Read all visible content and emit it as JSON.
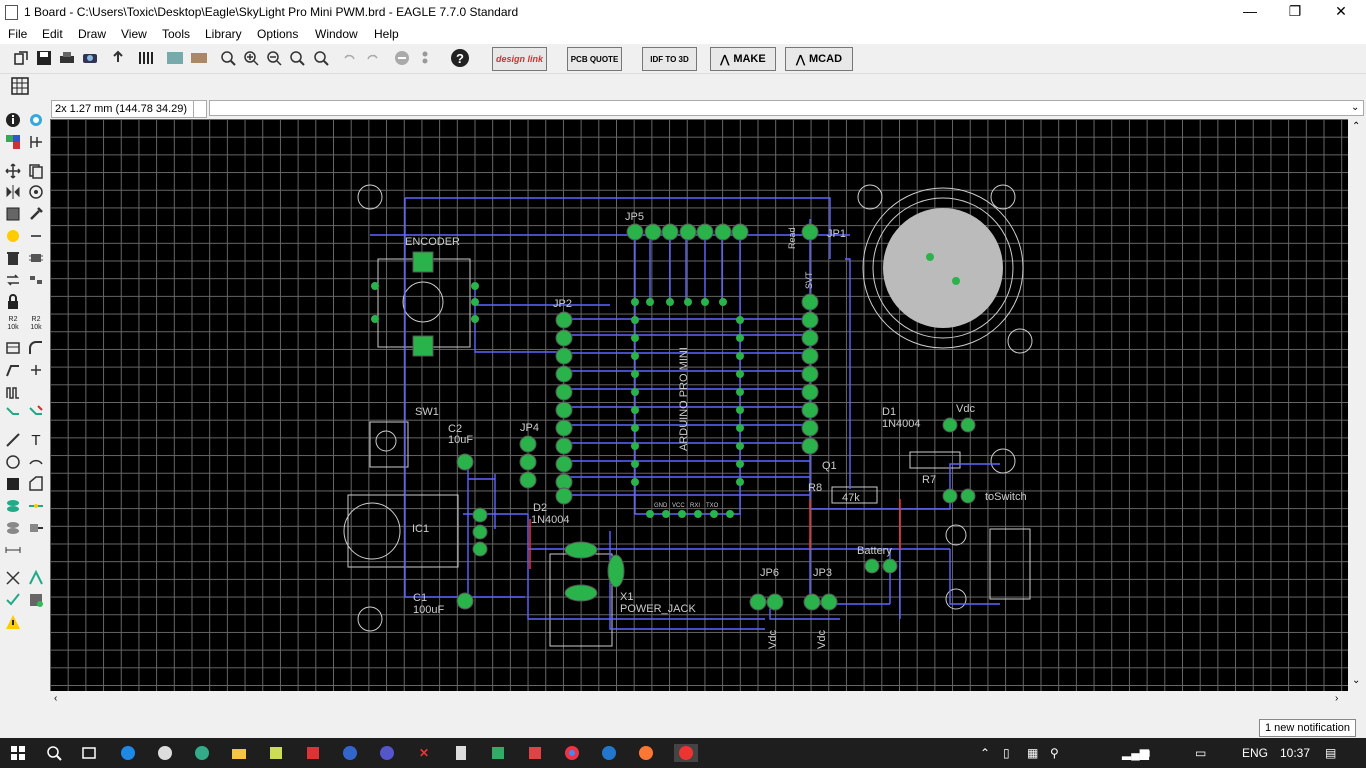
{
  "window": {
    "title": "1 Board - C:\\Users\\Toxic\\Desktop\\Eagle\\SkyLight Pro Mini PWM.brd - EAGLE 7.7.0 Standard",
    "minimize_glyph": "—",
    "maximize_glyph": "❐",
    "close_glyph": "✕"
  },
  "menu": [
    "File",
    "Edit",
    "Draw",
    "View",
    "Tools",
    "Library",
    "Options",
    "Window",
    "Help"
  ],
  "toolbar": {
    "help_glyph": "?",
    "design_link": "design link",
    "pcb_quote": "PCB QUOTE",
    "idf_to_3d": "IDF TO 3D",
    "make": "MAKE",
    "mcad": "MCAD"
  },
  "command_bar": {
    "coordinates": "2x 1.27 mm (144.78 34.29)",
    "command_value": ""
  },
  "left_toolbar": {
    "text_glyph": "T",
    "r2_top": "R2",
    "r2_bottom": "10k",
    "r2b_top": "R2",
    "r2b_bottom": "10k"
  },
  "board_labels": {
    "encoder": "ENCODER",
    "sw1": "SW1",
    "jp2": "JP2",
    "jp5": "JP5",
    "jp1": "JP1",
    "jp4": "JP4",
    "c2": "C2",
    "c2_value": "10uF",
    "c1": "C1",
    "c1_value": "100uF",
    "ic1": "IC1",
    "d2": "D2",
    "d2_value": "1N4004",
    "d1": "D1",
    "d1_value": "1N4004",
    "arduino": "ARDUINO PRO MINI",
    "vdc": "Vdc",
    "to_switch": "toSwitch",
    "battery": "Battery",
    "r8": "R8",
    "r8_value": "47k",
    "r7": "R7",
    "q1": "Q1",
    "jp6": "JP6",
    "jp3": "JP3",
    "vdc_jp6": "Vdc",
    "vdc_jp3": "Vdc",
    "x1": "X1",
    "power_jack": "POWER_JACK",
    "read": "Read",
    "svt": "SVT",
    "gnd": "GND",
    "vcc": "VCC",
    "rx": "RXI",
    "tx": "TXO"
  },
  "status": {
    "notification": "1 new notification"
  },
  "taskbar": {
    "language": "ENG",
    "time": "10:37"
  }
}
